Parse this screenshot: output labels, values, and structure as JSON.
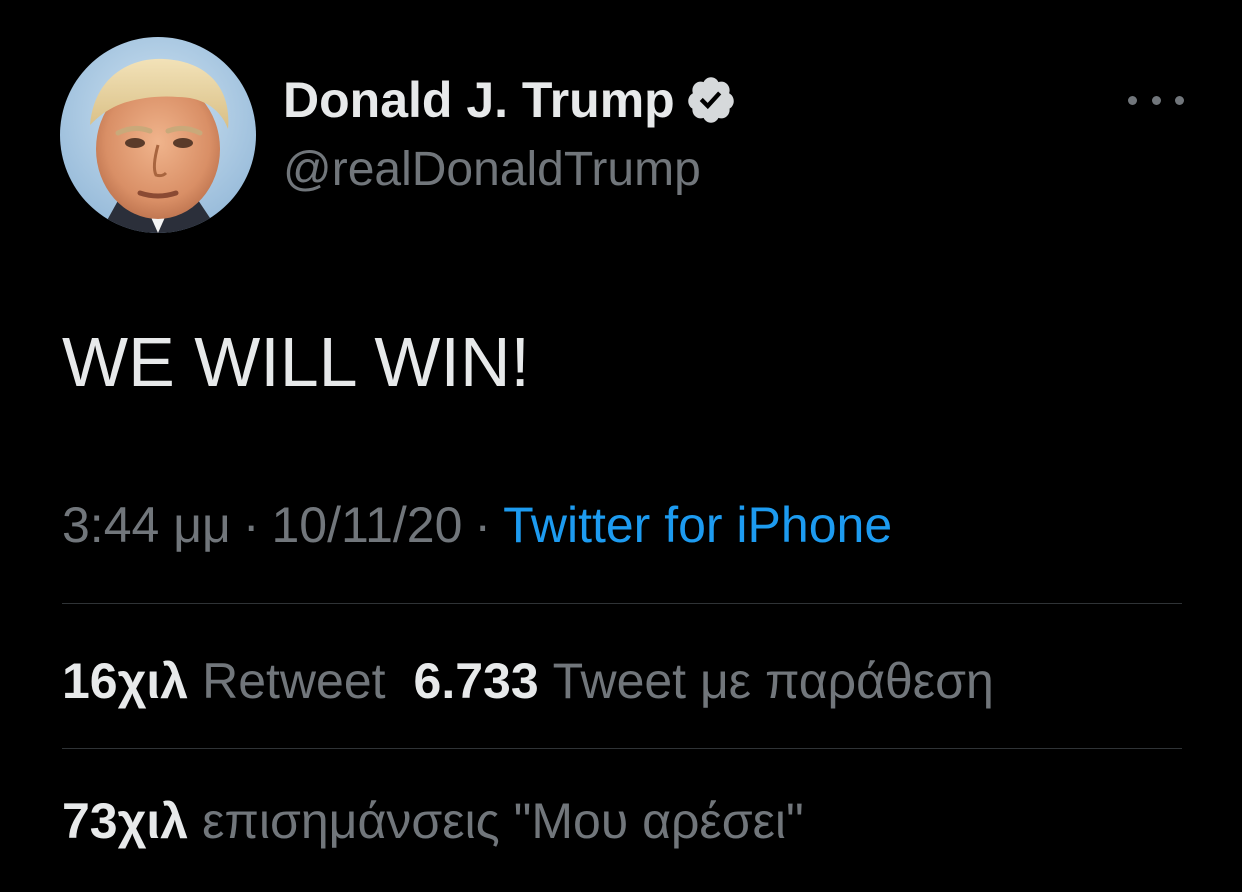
{
  "theme": {
    "background": "#000000",
    "primary_text": "#e7e9ea",
    "secondary_text": "#71767b",
    "link_color": "#1d9bf0",
    "divider_color": "#2f3336"
  },
  "author": {
    "display_name": "Donald J. Trump",
    "handle": "@realDonaldTrump",
    "verified": true,
    "avatar_icon": "profile-photo"
  },
  "tweet": {
    "text": "WE WILL WIN!",
    "time": "3:44 μμ",
    "separator": "·",
    "date": "10/11/20",
    "source": "Twitter for iPhone"
  },
  "stats": {
    "retweets": {
      "count": "16χιλ",
      "label": "Retweet"
    },
    "quotes": {
      "count": "6.733",
      "label": "Tweet με παράθεση"
    },
    "likes": {
      "count": "73χιλ",
      "label": "επισημάνσεις \"Μου αρέσει\""
    }
  },
  "icons": {
    "more": "more-horizontal-icon",
    "verified": "verified-badge-icon"
  }
}
